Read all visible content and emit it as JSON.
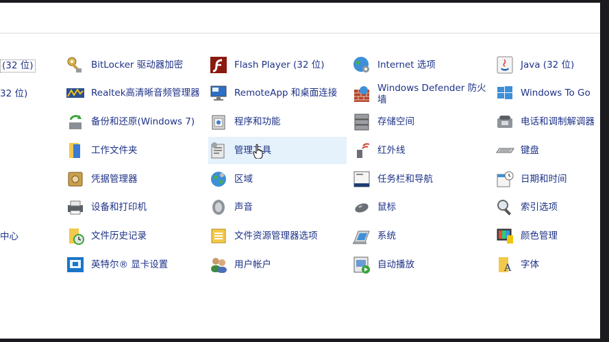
{
  "partial_left": [
    {
      "label": "(32 位)"
    },
    {
      "label": "32 位)"
    },
    {
      "label": "中心"
    }
  ],
  "items": [
    {
      "label": "BitLocker 驱动器加密",
      "icon": "bitlocker-key-icon"
    },
    {
      "label": "Realtek高清晰音频管理器",
      "icon": "realtek-audio-icon"
    },
    {
      "label": "备份和还原(Windows 7)",
      "icon": "backup-restore-icon"
    },
    {
      "label": "工作文件夹",
      "icon": "work-folders-icon"
    },
    {
      "label": "凭据管理器",
      "icon": "credential-manager-icon"
    },
    {
      "label": "设备和打印机",
      "icon": "devices-printers-icon"
    },
    {
      "label": "文件历史记录",
      "icon": "file-history-icon"
    },
    {
      "label": "英特尔® 显卡设置",
      "icon": "intel-graphics-icon"
    },
    {
      "label": "Flash Player (32 位)",
      "icon": "flash-player-icon"
    },
    {
      "label": "RemoteApp 和桌面连接",
      "icon": "remoteapp-icon"
    },
    {
      "label": "程序和功能",
      "icon": "programs-features-icon"
    },
    {
      "label": "管理工具",
      "icon": "admin-tools-icon"
    },
    {
      "label": "区域",
      "icon": "region-globe-icon"
    },
    {
      "label": "声音",
      "icon": "sound-speaker-icon"
    },
    {
      "label": "文件资源管理器选项",
      "icon": "explorer-options-icon"
    },
    {
      "label": "用户帐户",
      "icon": "user-accounts-icon"
    },
    {
      "label": "Internet 选项",
      "icon": "internet-options-icon"
    },
    {
      "label": "Windows Defender 防火墙",
      "icon": "firewall-icon"
    },
    {
      "label": "存储空间",
      "icon": "storage-spaces-icon"
    },
    {
      "label": "红外线",
      "icon": "infrared-icon"
    },
    {
      "label": "任务栏和导航",
      "icon": "taskbar-navigation-icon"
    },
    {
      "label": "鼠标",
      "icon": "mouse-icon"
    },
    {
      "label": "系统",
      "icon": "system-icon"
    },
    {
      "label": "自动播放",
      "icon": "autoplay-icon"
    },
    {
      "label": "Java (32 位)",
      "icon": "java-icon"
    },
    {
      "label": "Windows To Go",
      "icon": "windows-to-go-icon"
    },
    {
      "label": "电话和调制解调器",
      "icon": "phone-modem-icon"
    },
    {
      "label": "键盘",
      "icon": "keyboard-icon"
    },
    {
      "label": "日期和时间",
      "icon": "date-time-icon"
    },
    {
      "label": "索引选项",
      "icon": "indexing-options-icon"
    },
    {
      "label": "颜色管理",
      "icon": "color-management-icon"
    },
    {
      "label": "字体",
      "icon": "fonts-icon"
    }
  ]
}
